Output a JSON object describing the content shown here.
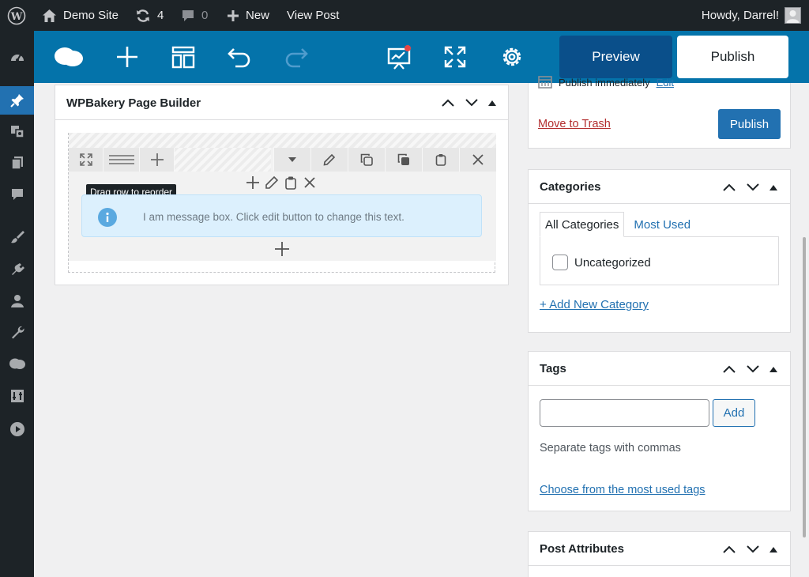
{
  "adminbar": {
    "site_name": "Demo Site",
    "updates_count": "4",
    "comments_count": "0",
    "new_label": "New",
    "view_post_label": "View Post",
    "howdy": "Howdy, Darrel!"
  },
  "vc_toolbar": {
    "preview_label": "Preview",
    "publish_label": "Publish",
    "accent_color": "#0473aa"
  },
  "page_builder": {
    "title": "WPBakery Page Builder",
    "tooltip": "Drag row to reorder",
    "message_text": "I am message box. Click edit button to change this text."
  },
  "publish_box": {
    "schedule_text": "Publish immediately",
    "edit_label": "Edit",
    "move_to_trash": "Move to Trash",
    "publish_label": "Publish"
  },
  "categories": {
    "title": "Categories",
    "tab_all": "All Categories",
    "tab_most_used": "Most Used",
    "items": [
      {
        "label": "Uncategorized",
        "checked": false
      }
    ],
    "add_new": "+ Add New Category"
  },
  "tags": {
    "title": "Tags",
    "input_value": "",
    "add_label": "Add",
    "help_text": "Separate tags with commas",
    "choose_link": "Choose from the most used tags"
  },
  "post_attributes": {
    "title": "Post Attributes"
  },
  "colors": {
    "admin_dark": "#1d2327",
    "wp_blue": "#2271b1",
    "danger": "#b32d2e",
    "message_bg": "#dcf0fd"
  }
}
